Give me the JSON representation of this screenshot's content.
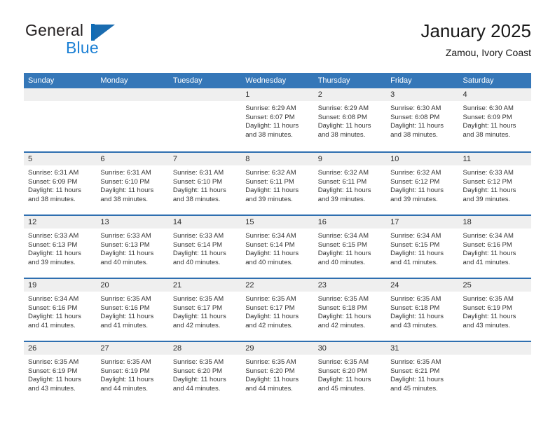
{
  "brand": {
    "name_dark": "General",
    "name_blue": "Blue",
    "mark": "blue-triangle-logo"
  },
  "header": {
    "title": "January 2025",
    "subtitle": "Zamou, Ivory Coast"
  },
  "colors": {
    "header_blue": "#3577b8",
    "row_divider_blue": "#2f6fb0",
    "day_band_gray": "#efefef",
    "brand_blue": "#1a7fd4",
    "text": "#333333"
  },
  "calendar": {
    "weekdays": [
      "Sunday",
      "Monday",
      "Tuesday",
      "Wednesday",
      "Thursday",
      "Friday",
      "Saturday"
    ],
    "weeks": [
      [
        {
          "day": "",
          "lines": []
        },
        {
          "day": "",
          "lines": []
        },
        {
          "day": "",
          "lines": []
        },
        {
          "day": "1",
          "lines": [
            "Sunrise: 6:29 AM",
            "Sunset: 6:07 PM",
            "Daylight: 11 hours",
            "and 38 minutes."
          ]
        },
        {
          "day": "2",
          "lines": [
            "Sunrise: 6:29 AM",
            "Sunset: 6:08 PM",
            "Daylight: 11 hours",
            "and 38 minutes."
          ]
        },
        {
          "day": "3",
          "lines": [
            "Sunrise: 6:30 AM",
            "Sunset: 6:08 PM",
            "Daylight: 11 hours",
            "and 38 minutes."
          ]
        },
        {
          "day": "4",
          "lines": [
            "Sunrise: 6:30 AM",
            "Sunset: 6:09 PM",
            "Daylight: 11 hours",
            "and 38 minutes."
          ]
        }
      ],
      [
        {
          "day": "5",
          "lines": [
            "Sunrise: 6:31 AM",
            "Sunset: 6:09 PM",
            "Daylight: 11 hours",
            "and 38 minutes."
          ]
        },
        {
          "day": "6",
          "lines": [
            "Sunrise: 6:31 AM",
            "Sunset: 6:10 PM",
            "Daylight: 11 hours",
            "and 38 minutes."
          ]
        },
        {
          "day": "7",
          "lines": [
            "Sunrise: 6:31 AM",
            "Sunset: 6:10 PM",
            "Daylight: 11 hours",
            "and 38 minutes."
          ]
        },
        {
          "day": "8",
          "lines": [
            "Sunrise: 6:32 AM",
            "Sunset: 6:11 PM",
            "Daylight: 11 hours",
            "and 39 minutes."
          ]
        },
        {
          "day": "9",
          "lines": [
            "Sunrise: 6:32 AM",
            "Sunset: 6:11 PM",
            "Daylight: 11 hours",
            "and 39 minutes."
          ]
        },
        {
          "day": "10",
          "lines": [
            "Sunrise: 6:32 AM",
            "Sunset: 6:12 PM",
            "Daylight: 11 hours",
            "and 39 minutes."
          ]
        },
        {
          "day": "11",
          "lines": [
            "Sunrise: 6:33 AM",
            "Sunset: 6:12 PM",
            "Daylight: 11 hours",
            "and 39 minutes."
          ]
        }
      ],
      [
        {
          "day": "12",
          "lines": [
            "Sunrise: 6:33 AM",
            "Sunset: 6:13 PM",
            "Daylight: 11 hours",
            "and 39 minutes."
          ]
        },
        {
          "day": "13",
          "lines": [
            "Sunrise: 6:33 AM",
            "Sunset: 6:13 PM",
            "Daylight: 11 hours",
            "and 40 minutes."
          ]
        },
        {
          "day": "14",
          "lines": [
            "Sunrise: 6:33 AM",
            "Sunset: 6:14 PM",
            "Daylight: 11 hours",
            "and 40 minutes."
          ]
        },
        {
          "day": "15",
          "lines": [
            "Sunrise: 6:34 AM",
            "Sunset: 6:14 PM",
            "Daylight: 11 hours",
            "and 40 minutes."
          ]
        },
        {
          "day": "16",
          "lines": [
            "Sunrise: 6:34 AM",
            "Sunset: 6:15 PM",
            "Daylight: 11 hours",
            "and 40 minutes."
          ]
        },
        {
          "day": "17",
          "lines": [
            "Sunrise: 6:34 AM",
            "Sunset: 6:15 PM",
            "Daylight: 11 hours",
            "and 41 minutes."
          ]
        },
        {
          "day": "18",
          "lines": [
            "Sunrise: 6:34 AM",
            "Sunset: 6:16 PM",
            "Daylight: 11 hours",
            "and 41 minutes."
          ]
        }
      ],
      [
        {
          "day": "19",
          "lines": [
            "Sunrise: 6:34 AM",
            "Sunset: 6:16 PM",
            "Daylight: 11 hours",
            "and 41 minutes."
          ]
        },
        {
          "day": "20",
          "lines": [
            "Sunrise: 6:35 AM",
            "Sunset: 6:16 PM",
            "Daylight: 11 hours",
            "and 41 minutes."
          ]
        },
        {
          "day": "21",
          "lines": [
            "Sunrise: 6:35 AM",
            "Sunset: 6:17 PM",
            "Daylight: 11 hours",
            "and 42 minutes."
          ]
        },
        {
          "day": "22",
          "lines": [
            "Sunrise: 6:35 AM",
            "Sunset: 6:17 PM",
            "Daylight: 11 hours",
            "and 42 minutes."
          ]
        },
        {
          "day": "23",
          "lines": [
            "Sunrise: 6:35 AM",
            "Sunset: 6:18 PM",
            "Daylight: 11 hours",
            "and 42 minutes."
          ]
        },
        {
          "day": "24",
          "lines": [
            "Sunrise: 6:35 AM",
            "Sunset: 6:18 PM",
            "Daylight: 11 hours",
            "and 43 minutes."
          ]
        },
        {
          "day": "25",
          "lines": [
            "Sunrise: 6:35 AM",
            "Sunset: 6:19 PM",
            "Daylight: 11 hours",
            "and 43 minutes."
          ]
        }
      ],
      [
        {
          "day": "26",
          "lines": [
            "Sunrise: 6:35 AM",
            "Sunset: 6:19 PM",
            "Daylight: 11 hours",
            "and 43 minutes."
          ]
        },
        {
          "day": "27",
          "lines": [
            "Sunrise: 6:35 AM",
            "Sunset: 6:19 PM",
            "Daylight: 11 hours",
            "and 44 minutes."
          ]
        },
        {
          "day": "28",
          "lines": [
            "Sunrise: 6:35 AM",
            "Sunset: 6:20 PM",
            "Daylight: 11 hours",
            "and 44 minutes."
          ]
        },
        {
          "day": "29",
          "lines": [
            "Sunrise: 6:35 AM",
            "Sunset: 6:20 PM",
            "Daylight: 11 hours",
            "and 44 minutes."
          ]
        },
        {
          "day": "30",
          "lines": [
            "Sunrise: 6:35 AM",
            "Sunset: 6:20 PM",
            "Daylight: 11 hours",
            "and 45 minutes."
          ]
        },
        {
          "day": "31",
          "lines": [
            "Sunrise: 6:35 AM",
            "Sunset: 6:21 PM",
            "Daylight: 11 hours",
            "and 45 minutes."
          ]
        },
        {
          "day": "",
          "lines": []
        }
      ]
    ]
  }
}
